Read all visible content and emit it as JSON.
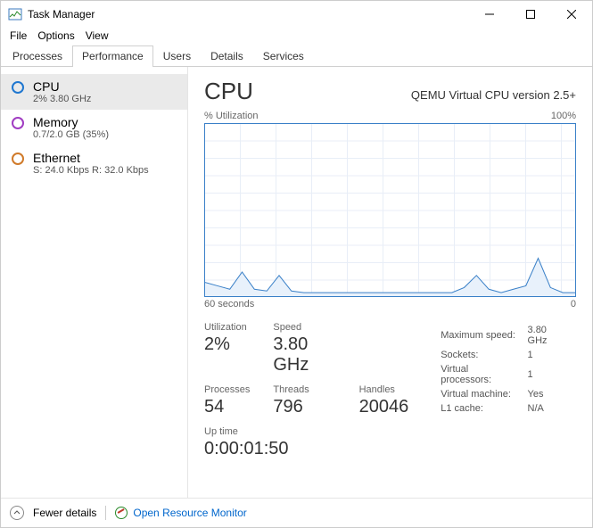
{
  "window": {
    "title": "Task Manager"
  },
  "menu": {
    "file": "File",
    "options": "Options",
    "view": "View"
  },
  "tabs": {
    "processes": "Processes",
    "performance": "Performance",
    "users": "Users",
    "details": "Details",
    "services": "Services"
  },
  "side": {
    "cpu": {
      "label": "CPU",
      "sub": "2% 3.80 GHz"
    },
    "memory": {
      "label": "Memory",
      "sub": "0.7/2.0 GB (35%)"
    },
    "ethernet": {
      "label": "Ethernet",
      "sub": "S: 24.0 Kbps R: 32.0 Kbps"
    }
  },
  "detail": {
    "title": "CPU",
    "subtitle": "QEMU Virtual CPU version 2.5+",
    "ylabel_left": "% Utilization",
    "ylabel_right": "100%",
    "xlabel_left": "60 seconds",
    "xlabel_right": "0",
    "stats": {
      "utilization_label": "Utilization",
      "utilization": "2%",
      "speed_label": "Speed",
      "speed": "3.80 GHz",
      "processes_label": "Processes",
      "processes": "54",
      "threads_label": "Threads",
      "threads": "796",
      "handles_label": "Handles",
      "handles": "20046",
      "uptime_label": "Up time",
      "uptime": "0:00:01:50"
    },
    "right": {
      "max_speed_label": "Maximum speed:",
      "max_speed": "3.80 GHz",
      "sockets_label": "Sockets:",
      "sockets": "1",
      "vprocs_label": "Virtual processors:",
      "vprocs": "1",
      "vm_label": "Virtual machine:",
      "vm": "Yes",
      "l1_label": "L1 cache:",
      "l1": "N/A"
    }
  },
  "bottom": {
    "fewer": "Fewer details",
    "rm": "Open Resource Monitor"
  },
  "chart_data": {
    "type": "line",
    "title": "CPU % Utilization",
    "xlabel": "seconds ago",
    "ylabel": "% Utilization",
    "ylim": [
      0,
      100
    ],
    "xrange": [
      60,
      0
    ],
    "x": [
      60,
      58,
      56,
      54,
      52,
      50,
      48,
      46,
      44,
      42,
      40,
      38,
      36,
      34,
      32,
      30,
      28,
      26,
      24,
      22,
      20,
      18,
      16,
      14,
      12,
      10,
      8,
      6,
      4,
      2,
      0
    ],
    "values": [
      8,
      6,
      4,
      14,
      4,
      3,
      12,
      3,
      2,
      2,
      2,
      2,
      2,
      2,
      2,
      2,
      2,
      2,
      2,
      2,
      2,
      5,
      12,
      4,
      2,
      4,
      6,
      22,
      5,
      2,
      2
    ]
  }
}
